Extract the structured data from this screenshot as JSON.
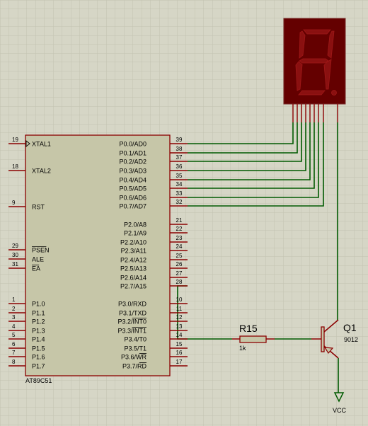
{
  "colors": {
    "background": "#d6d6c6",
    "grid": "#c4c4b2",
    "chip_body": "#c6c6a8",
    "pin": "#8b0000",
    "wire": "#005a00",
    "display_bg": "#640000",
    "segment_off": "#8a1010",
    "text": "#000000"
  },
  "chip": {
    "name": "AT89C51",
    "left_pins": [
      {
        "num": "19",
        "label": "XTAL1"
      },
      {
        "num": "18",
        "label": "XTAL2"
      },
      {
        "num": "9",
        "label": "RST"
      },
      {
        "num": "29",
        "label": "PSEN"
      },
      {
        "num": "30",
        "label": "ALE"
      },
      {
        "num": "31",
        "label": "EA"
      },
      {
        "num": "1",
        "label": "P1.0"
      },
      {
        "num": "2",
        "label": "P1.1"
      },
      {
        "num": "3",
        "label": "P1.2"
      },
      {
        "num": "4",
        "label": "P1.3"
      },
      {
        "num": "5",
        "label": "P1.4"
      },
      {
        "num": "6",
        "label": "P1.5"
      },
      {
        "num": "7",
        "label": "P1.6"
      },
      {
        "num": "8",
        "label": "P1.7"
      }
    ],
    "right_pins": [
      {
        "num": "39",
        "label": "P0.0/AD0"
      },
      {
        "num": "38",
        "label": "P0.1/AD1"
      },
      {
        "num": "37",
        "label": "P0.2/AD2"
      },
      {
        "num": "36",
        "label": "P0.3/AD3"
      },
      {
        "num": "35",
        "label": "P0.4/AD4"
      },
      {
        "num": "34",
        "label": "P0.5/AD5"
      },
      {
        "num": "33",
        "label": "P0.6/AD6"
      },
      {
        "num": "32",
        "label": "P0.7/AD7"
      },
      {
        "num": "21",
        "label": "P2.0/A8"
      },
      {
        "num": "22",
        "label": "P2.1/A9"
      },
      {
        "num": "23",
        "label": "P2.2/A10"
      },
      {
        "num": "24",
        "label": "P2.3/A11"
      },
      {
        "num": "25",
        "label": "P2.4/A12"
      },
      {
        "num": "26",
        "label": "P2.5/A13"
      },
      {
        "num": "27",
        "label": "P2.6/A14"
      },
      {
        "num": "28",
        "label": "P2.7/A15"
      },
      {
        "num": "10",
        "label": "P3.0/RXD"
      },
      {
        "num": "11",
        "label": "P3.1/TXD"
      },
      {
        "num": "12",
        "label": "P3.2/INT0"
      },
      {
        "num": "13",
        "label": "P3.3/INT1"
      },
      {
        "num": "14",
        "label": "P3.4/T0"
      },
      {
        "num": "15",
        "label": "P3.5/T1"
      },
      {
        "num": "16",
        "label": "P3.6/WR"
      },
      {
        "num": "17",
        "label": "P3.7/RD"
      }
    ]
  },
  "resistor": {
    "ref": "R15",
    "value": "1k"
  },
  "transistor": {
    "ref": "Q1",
    "part": "9012"
  },
  "power": {
    "label": "VCC"
  }
}
